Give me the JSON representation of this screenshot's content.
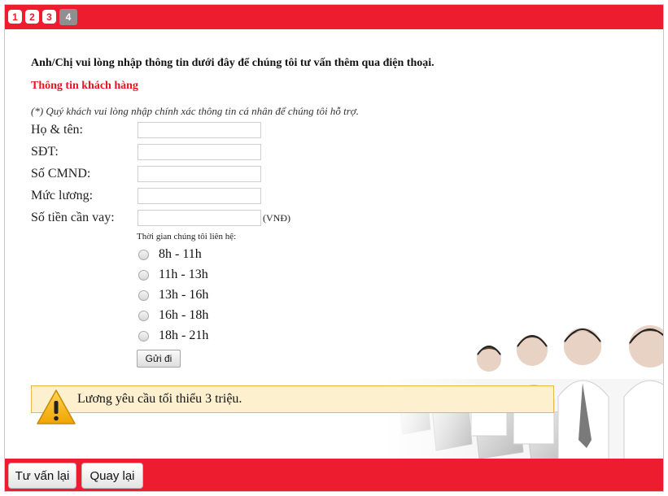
{
  "steps": [
    "1",
    "2",
    "3",
    "4"
  ],
  "active_step": "4",
  "intro": "Anh/Chị vui lòng nhập thông tin dưới đây để chúng tôi tư vấn thêm qua điện thoại.",
  "section_title": "Thông tin khách hàng",
  "note": "(*) Quý khách vui lòng nhập chính xác thông tin cá nhân để chúng tôi hỗ trợ.",
  "fields": {
    "name": {
      "label": "Họ & tên:",
      "value": ""
    },
    "phone": {
      "label": "SĐT:",
      "value": ""
    },
    "id_number": {
      "label": "Số CMND:",
      "value": ""
    },
    "salary": {
      "label": "Mức lương:",
      "value": ""
    },
    "loan_amount": {
      "label": "Số tiền cần vay:",
      "value": "",
      "unit": "(VNĐ)"
    }
  },
  "contact_time": {
    "label": "Thời gian chúng tôi liên hệ:",
    "options": [
      "8h - 11h",
      "11h - 13h",
      "13h - 16h",
      "16h - 18h",
      "18h - 21h"
    ],
    "selected": null
  },
  "submit_label": "Gửi đi",
  "alert_message": "Lương yêu cầu tối thiểu 3 triệu.",
  "bottom_buttons": {
    "consult_again": "Tư vấn lại",
    "back": "Quay lại"
  },
  "colors": {
    "brand_red": "#ee1c2f",
    "alert_bg": "#fdf0cf",
    "alert_border": "#e6b947",
    "active_step": "#8f8f8f"
  }
}
